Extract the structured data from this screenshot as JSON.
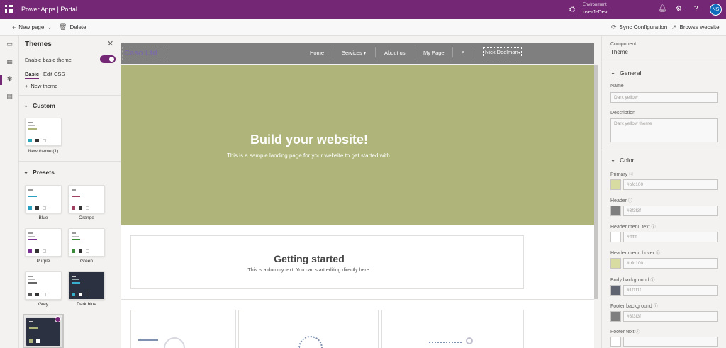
{
  "topbar": {
    "app_name": "Power Apps  |  Portal",
    "environment_label": "Environment",
    "environment_value": "user1-Dev",
    "avatar_initials": "NS"
  },
  "command_bar": {
    "new_page": "New page",
    "delete": "Delete",
    "sync": "Sync Configuration",
    "browse": "Browse website"
  },
  "themes_panel": {
    "title": "Themes",
    "enable_basic_theme": "Enable basic theme",
    "tabs": [
      "Basic",
      "Edit CSS"
    ],
    "new_theme": "New theme",
    "custom_header": "Custom",
    "custom_items": [
      {
        "label": "New theme (1)"
      }
    ],
    "presets_header": "Presets",
    "presets": [
      {
        "label": "Blue"
      },
      {
        "label": "Orange"
      },
      {
        "label": "Purple"
      },
      {
        "label": "Green"
      },
      {
        "label": "Grey"
      },
      {
        "label": "Dark blue"
      }
    ]
  },
  "preview": {
    "logo": "Caso Ltd",
    "nav": [
      "Home",
      "Services",
      "About us",
      "My Page"
    ],
    "user": "Nick Doelman",
    "hero_title": "Build your website!",
    "hero_subtitle": "This is a sample landing page for your website to get started with.",
    "gs_title": "Getting started",
    "gs_subtitle": "This is a dummy text. You can start editing directly here."
  },
  "properties": {
    "component_label": "Component",
    "component_value": "Theme",
    "general_header": "General",
    "name_label": "Name",
    "name_value": "Dark yellow",
    "description_label": "Description",
    "description_value": "Dark yellow theme",
    "color_header": "Color",
    "colors": [
      {
        "label": "Primary",
        "value": "#bfc100",
        "swatch": "#d8dca0"
      },
      {
        "label": "Header",
        "value": "#3f3f3f",
        "swatch": "#7f7f7f"
      },
      {
        "label": "Header menu text",
        "value": "#ffffff",
        "swatch": "#ffffff"
      },
      {
        "label": "Header menu hover",
        "value": "#bfc100",
        "swatch": "#d8dca0"
      },
      {
        "label": "Body background",
        "value": "#1f1f1f",
        "swatch": "#5f6470"
      },
      {
        "label": "Footer background",
        "value": "#3f3f3f",
        "swatch": "#7f7f7f"
      },
      {
        "label": "Footer text",
        "value": "",
        "swatch": "#ffffff"
      }
    ]
  },
  "accent_color": "#742774"
}
